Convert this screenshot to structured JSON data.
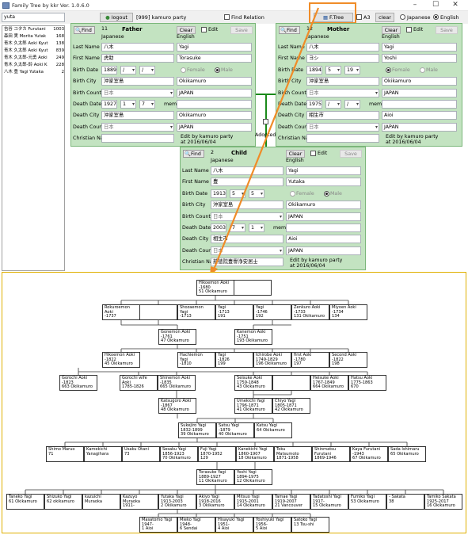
{
  "window": {
    "title": "Family Tree by kkr  Ver. 1.0.6.0",
    "minimize": "–",
    "maximize": "☐",
    "close": "✕"
  },
  "topbar": {
    "search_value": "yuta",
    "logout_label": "logout",
    "user_label": "[999] kamuro party",
    "find_relation_label": "Find Relation",
    "ftree_label": "F.Tree",
    "a3_label": "A3",
    "clear_label": "clear",
    "lang_japanese": "Japanese",
    "lang_english": "English",
    "lang_selected": "English"
  },
  "search_results": [
    {
      "name": "吉谷 ユタカ Furutani",
      "count": "1003"
    },
    {
      "name": "森田 実 Morita  Yutak",
      "count": "168"
    },
    {
      "name": "青木 久太郎 Aoki Kyut",
      "count": "138"
    },
    {
      "name": "青木 久太郎 Aoki Kyut",
      "count": "839"
    },
    {
      "name": "青木 久太郎-元勇 Aoki",
      "count": "249"
    },
    {
      "name": "青木 久太郎-鈴 Aoki K",
      "count": "228"
    },
    {
      "name": "八木 豊 Yagi Yutaka",
      "count": "2"
    }
  ],
  "labels": {
    "find": "Find",
    "clear": "Clear",
    "edit": "Edit",
    "save": "Save",
    "japanese": "Japanese",
    "english": "English",
    "last_name": "Last Name",
    "first_name": "First Name",
    "birth_date": "Birth Date",
    "birth_city": "Birth City",
    "birth_country": "Birth Country",
    "death_date": "Death Date",
    "death_city": "Death City",
    "death_country": "Death Country",
    "christian_name": "Christian Name",
    "female": "Female",
    "male": "Male",
    "memo": "memo",
    "adopted": "Adopted"
  },
  "father": {
    "id": "11",
    "role": "Father",
    "last_jp": "八木",
    "last_en": "Yagi",
    "first_jp": "虎助",
    "first_en": "Torasuke",
    "birth_y": "1889",
    "birth_m": "/",
    "birth_d": "/",
    "birth_city_jp": "沖家室島",
    "birth_city_en": "Okikamuro",
    "birth_country_jp": "日本",
    "birth_country_en": "JAPAN",
    "death_y": "1927",
    "death_m": "1",
    "death_d": "7",
    "death_city_jp": "沖家室島",
    "death_city_en": "Okikamuro",
    "death_country_jp": "日本",
    "death_country_en": "JAPAN",
    "christian_jp": "",
    "edit_by": "Edit by kamuro party",
    "edit_at": "at 2016/06/04",
    "gender": "Male"
  },
  "mother": {
    "id": "12",
    "role": "Mother",
    "last_jp": "八木",
    "last_en": "Yagi",
    "first_jp": "ヨシ",
    "first_en": "Yoshi",
    "birth_y": "1894",
    "birth_m": "5",
    "birth_d": "19",
    "birth_city_jp": "沖家室島",
    "birth_city_en": "Okikamuro",
    "birth_country_jp": "日本",
    "birth_country_en": "JAPAN",
    "death_y": "1975",
    "death_m": "/",
    "death_d": "/",
    "death_city_jp": "相生市",
    "death_city_en": "Aioi",
    "death_country_jp": "日本",
    "death_country_en": "JAPAN",
    "christian_jp": "",
    "edit_by": "Edit by kamuro party",
    "edit_at": "at 2016/06/04",
    "gender": "Female"
  },
  "child": {
    "id": "2",
    "role": "Child",
    "last_jp": "八木",
    "last_en": "Yagi",
    "first_jp": "豊",
    "first_en": "Yutaka",
    "birth_y": "1913",
    "birth_m": "5",
    "birth_d": "5",
    "birth_city_jp": "沖家室島",
    "birth_city_en": "Okikamuro",
    "birth_country_jp": "日本",
    "birth_country_en": "JAPAN",
    "death_y": "2003",
    "death_m": "7",
    "death_d": "1",
    "death_city_jp": "相生市",
    "death_city_en": "Aioi",
    "death_country_jp": "日本",
    "death_country_en": "JAPAN",
    "christian_jp": "慈徳院豊譽浄安居士",
    "edit_by": "Edit by kamuro party",
    "edit_at": "at 2016/06/04",
    "gender": "Male"
  },
  "tree": {
    "nodes": [
      {
        "id": "n1",
        "l1": "Hikoemon Aoki",
        "l2": "-1680",
        "l3": "51 Okikamuro"
      },
      {
        "id": "n2",
        "l1": "",
        "l2": "",
        "l3": ""
      },
      {
        "id": "n3",
        "l1": "Rokuroemon",
        "l2": "Aoki",
        "l3": "-1737"
      },
      {
        "id": "n4",
        "l1": "",
        "l2": "",
        "l3": ""
      },
      {
        "id": "n5",
        "l1": "Shozaemon",
        "l2": "Yagi",
        "l3": "-1713"
      },
      {
        "id": "n6",
        "l1": "Yagi",
        "l2": "-1713",
        "l3": "191"
      },
      {
        "id": "n7",
        "l1": "Yagi",
        "l2": "-1746",
        "l3": "192"
      },
      {
        "id": "n8",
        "l1": "Zenkuro Aoki",
        "l2": "-1733",
        "l3": "131 Okikamuro"
      },
      {
        "id": "n9",
        "l1": "Miyoen Aoki",
        "l2": "-1734",
        "l3": "134"
      },
      {
        "id": "n10",
        "l1": "Gonemon Aoki",
        "l2": "-1761",
        "l3": "47 Okikamuro"
      },
      {
        "id": "n11",
        "l1": "Kanemon Aoki",
        "l2": "-1751",
        "l3": "193 Okikamuro"
      },
      {
        "id": "n12",
        "l1": "Hikoemon Aoki",
        "l2": "-1822",
        "l3": "45 Okikamuro"
      },
      {
        "id": "n13",
        "l1": "Hachiemon",
        "l2": "Yagi",
        "l3": "-1810"
      },
      {
        "id": "n14",
        "l1": "Yagi",
        "l2": "-1826",
        "l3": "199"
      },
      {
        "id": "n15",
        "l1": "Ichirobe Aoki",
        "l2": "1749-1829",
        "l3": "196 Okikamuro"
      },
      {
        "id": "n16",
        "l1": "first  Aoki",
        "l2": "-1780",
        "l3": "197"
      },
      {
        "id": "n17",
        "l1": "Second Aoki",
        "l2": "-1822",
        "l3": "198"
      },
      {
        "id": "n18",
        "l1": "Gorochi Aoki",
        "l2": "-1823",
        "l3": "663 Okikamuro"
      },
      {
        "id": "n19",
        "l1": "Gorochi wife",
        "l2": "Aoki",
        "l3": "1785-1826"
      },
      {
        "id": "n20",
        "l1": "Shinemon Aoki",
        "l2": "-1835",
        "l3": "665 Okikamuro"
      },
      {
        "id": "n21",
        "l1": "Seisuke Aoki",
        "l2": "1759-1848",
        "l3": "43 Okikamuro"
      },
      {
        "id": "n22",
        "l1": "",
        "l2": "",
        "l3": ""
      },
      {
        "id": "n23",
        "l1": "Heisuke Aoki",
        "l2": "1767-1849",
        "l3": "664 Okikamuro"
      },
      {
        "id": "n24",
        "l1": "Hatsu Aoki",
        "l2": "1775-1863",
        "l3": "670"
      },
      {
        "id": "n25",
        "l1": "Katsugoro Aoki",
        "l2": "-1867",
        "l3": "48 Okikamuro"
      },
      {
        "id": "n26",
        "l1": "Umekichi Yagi",
        "l2": "1796-1871",
        "l3": "41 Okikamuro"
      },
      {
        "id": "n27",
        "l1": "Chiyo Yagi",
        "l2": "1805-1871",
        "l3": "42 Okikamuro"
      },
      {
        "id": "n28",
        "l1": "Sukejiro Yagi",
        "l2": "1832-1899",
        "l3": "39 Okikamuro"
      },
      {
        "id": "n29",
        "l1": "Satsu Yagi",
        "l2": "-1879",
        "l3": "40 Okikamuro"
      },
      {
        "id": "n30",
        "l1": "Katsu Yagi",
        "l2": "",
        "l3": "64 Okikamuro"
      },
      {
        "id": "n31",
        "l1": "Shimo Maruo",
        "l2": "",
        "l3": "71"
      },
      {
        "id": "n32",
        "l1": "Kamekichi",
        "l2": "Yanagihara",
        "l3": ""
      },
      {
        "id": "n33",
        "l1": "Usaku Otani",
        "l2": "",
        "l3": "73"
      },
      {
        "id": "n34",
        "l1": "Sesaku Yagi",
        "l2": "1856-1923",
        "l3": "70 Okikamuro"
      },
      {
        "id": "n35",
        "l1": "Fuji Yagi",
        "l2": "1870-1952",
        "l3": "129"
      },
      {
        "id": "n36",
        "l1": "Kanekichi Yagi",
        "l2": "1860-1907",
        "l3": "18 Okikamuro"
      },
      {
        "id": "n37",
        "l1": "Toku",
        "l2": "Matsumoto",
        "l3": "1871-1958"
      },
      {
        "id": "n38",
        "l1": "Shinmatsu",
        "l2": "Furutani",
        "l3": "1869-1946"
      },
      {
        "id": "n39",
        "l1": "Kaya Furutani",
        "l2": "-1943",
        "l3": "67 Okikamuro"
      },
      {
        "id": "n40",
        "l1": "Sada Ishimaru",
        "l2": "",
        "l3": "65 Okikamuro"
      },
      {
        "id": "n41",
        "l1": "Torasuke Yagi",
        "l2": "1889-1927",
        "l3": "11 Okikamuro"
      },
      {
        "id": "n42",
        "l1": "Yoshi Yagi",
        "l2": "1894-1975",
        "l3": "12 Okikamuro"
      },
      {
        "id": "n43",
        "l1": "Taneko Yagi",
        "l2": "",
        "l3": "61 Okikamuro"
      },
      {
        "id": "n44",
        "l1": "Shizuko Yagi",
        "l2": "",
        "l3": "62 okikamuro"
      },
      {
        "id": "n45",
        "l1": "kazuichi",
        "l2": "Muraoka",
        "l3": ""
      },
      {
        "id": "n46",
        "l1": "Kazuyo",
        "l2": "Muraoka",
        "l3": "1911-"
      },
      {
        "id": "n47",
        "l1": "Yutaka Yagi",
        "l2": "1913-2003",
        "l3": "2 Okikamuro"
      },
      {
        "id": "n48",
        "l1": "Akiyo Yagi",
        "l2": "1918-2016",
        "l3": "3 Okikamuro"
      },
      {
        "id": "n49",
        "l1": "Mitsuo Yagi",
        "l2": "1915-2001",
        "l3": "14 Okikamuro"
      },
      {
        "id": "n50",
        "l1": "Tamae Yagi",
        "l2": "1919-2007",
        "l3": "21 Vancouver"
      },
      {
        "id": "n51",
        "l1": "Tadatoshi Yagi",
        "l2": "1917-",
        "l3": "15 Okikamuro"
      },
      {
        "id": "n52",
        "l1": "Fumiko Yagi",
        "l2": "",
        "l3": "53 Okikamuro"
      },
      {
        "id": "n53",
        "l1": "- Sakata",
        "l2": "",
        "l3": "38"
      },
      {
        "id": "n54",
        "l1": "Tamiko Sakata",
        "l2": "1925-2017",
        "l3": "16 Okikamuro"
      },
      {
        "id": "n55",
        "l1": "Masatomo Yagi",
        "l2": "1947-",
        "l3": "1 Aioi"
      },
      {
        "id": "n56",
        "l1": "Mieko Yagi",
        "l2": "1948-",
        "l3": "6 Sendai"
      },
      {
        "id": "n57",
        "l1": "Hisayuki Yagi",
        "l2": "1951-",
        "l3": "4 Aioi"
      },
      {
        "id": "n58",
        "l1": "Yoshiyuki Yagi",
        "l2": "1956-",
        "l3": "5 Aioi"
      },
      {
        "id": "n59",
        "l1": "Satoko Yagi",
        "l2": "",
        "l3": "13 Tsu-shi"
      }
    ]
  },
  "colors": {
    "panel": "#c3e3c1",
    "highlight": "#f08c28",
    "tree_border": "#e0b000",
    "line_green": "#1a8a1a"
  }
}
